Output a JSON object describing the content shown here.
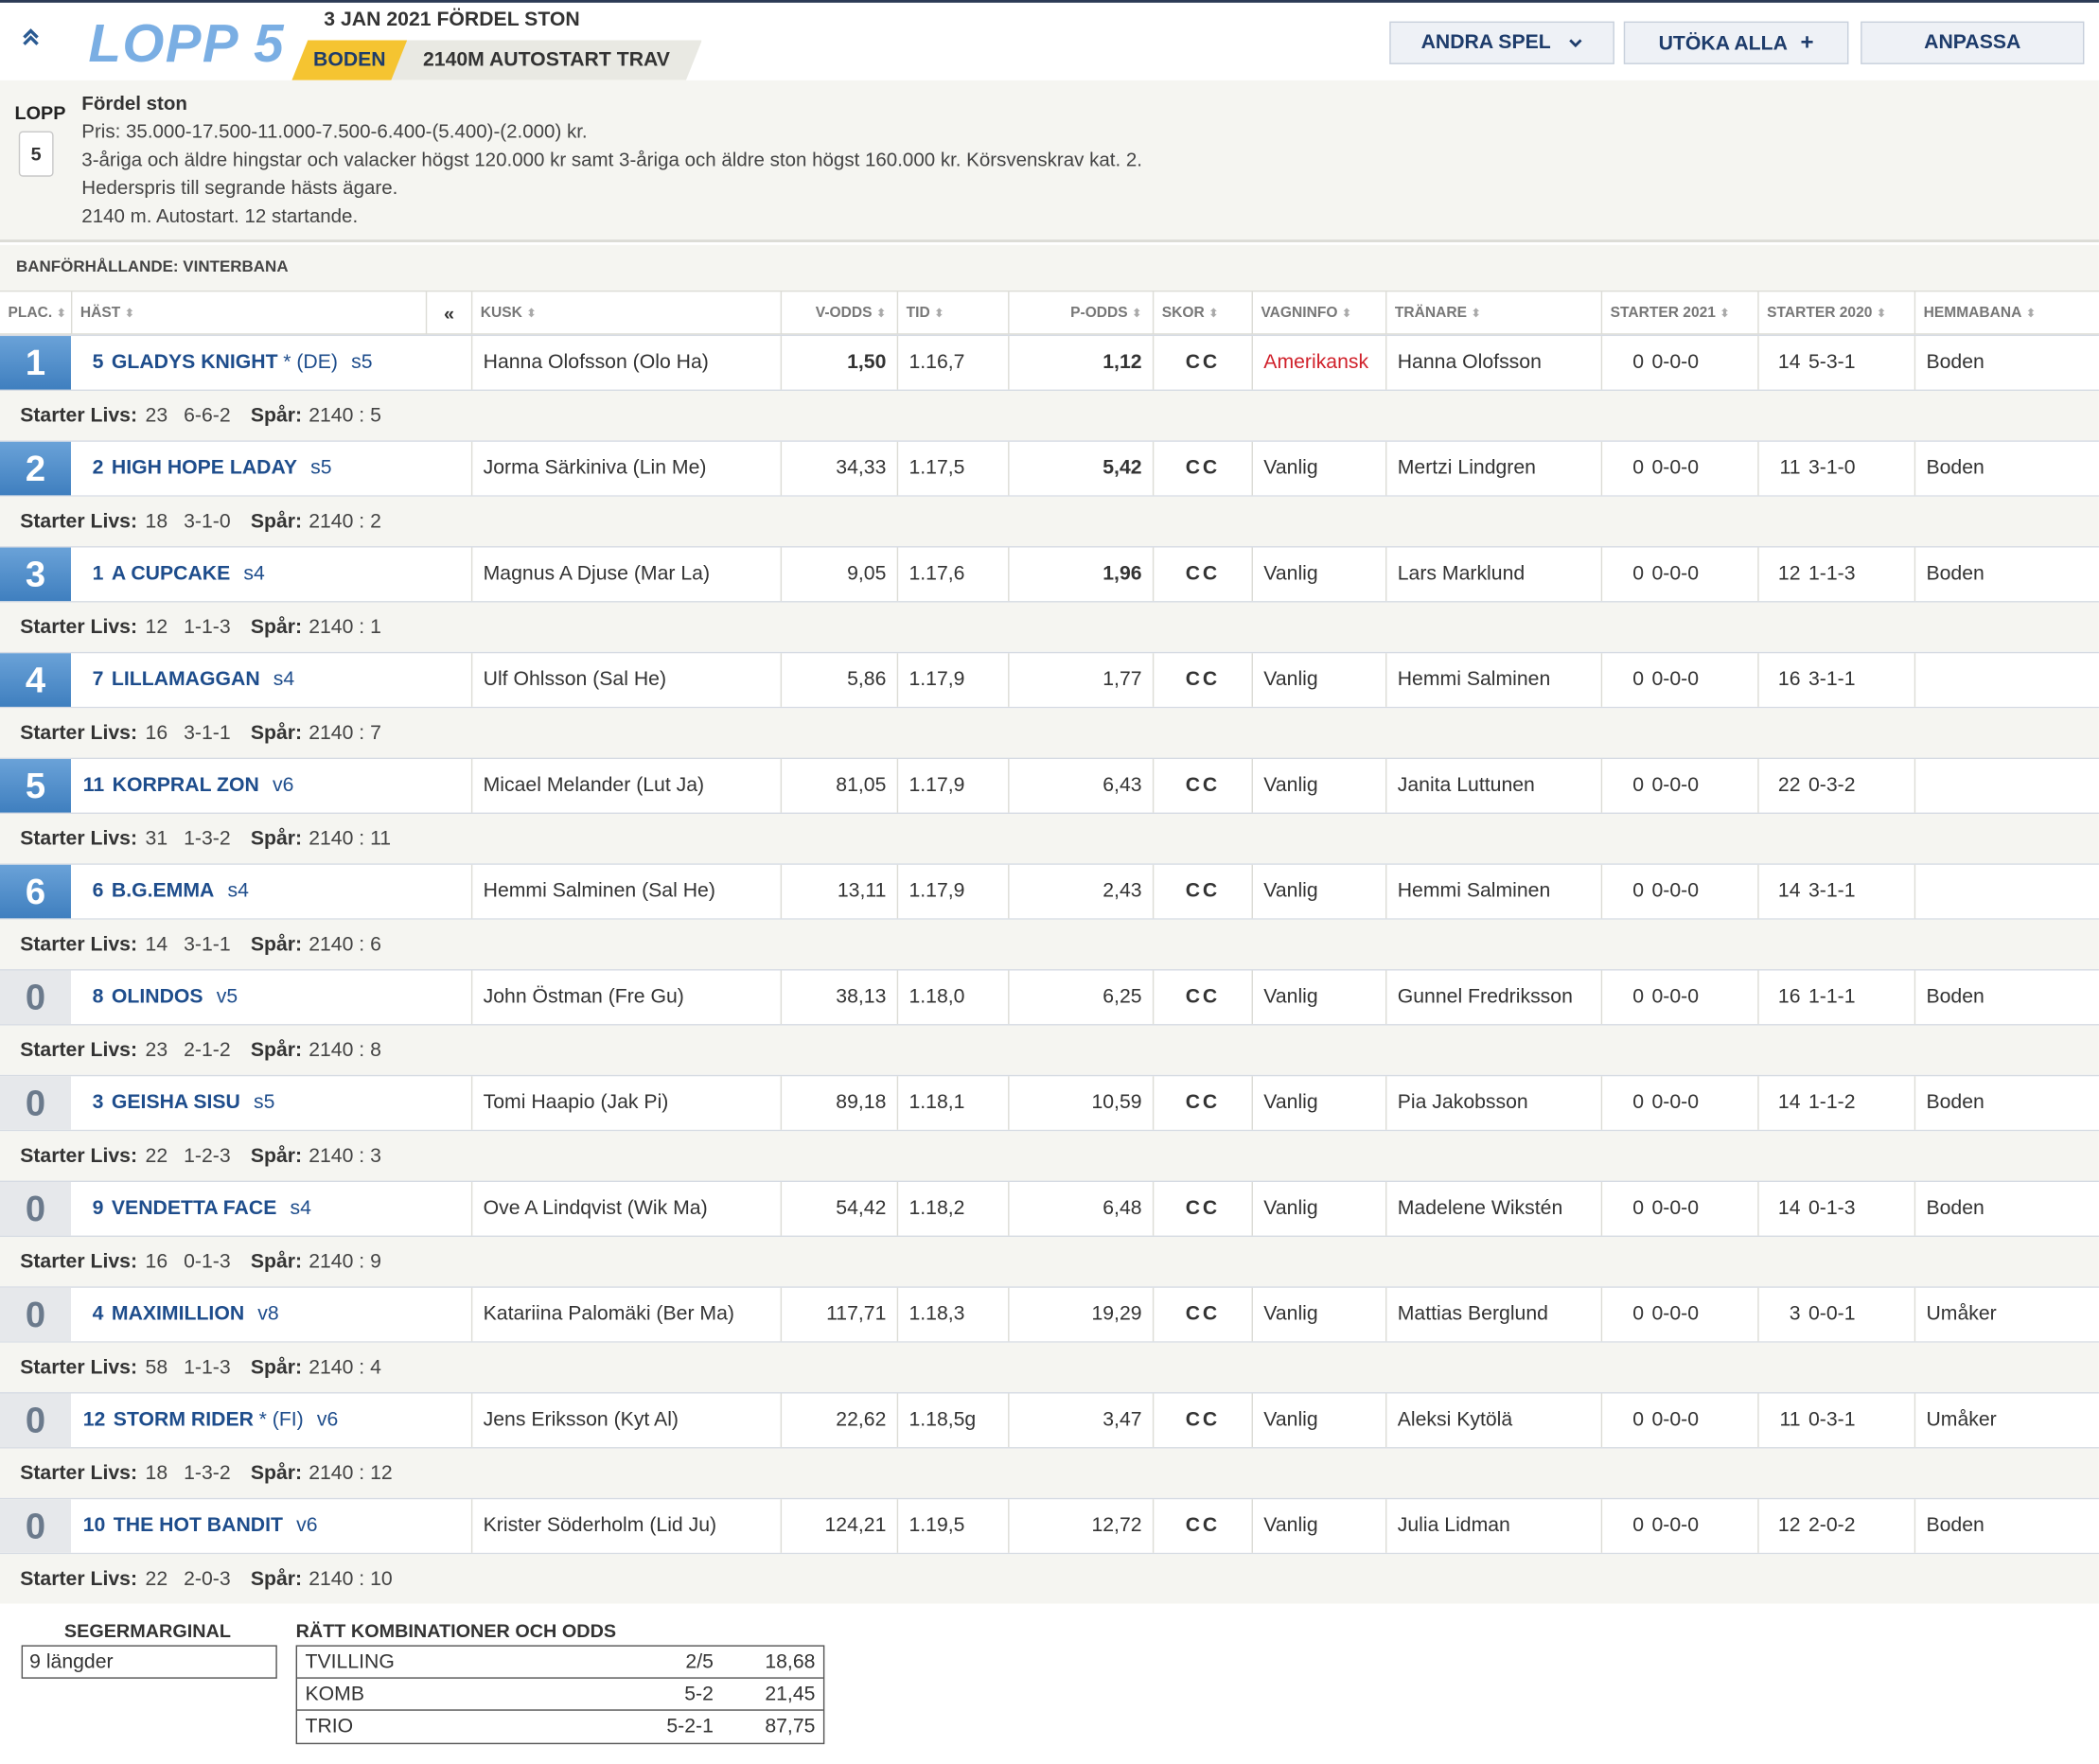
{
  "header": {
    "title": "LOPP 5",
    "date": "3 JAN 2021 FÖRDEL STON",
    "venue": "BODEN",
    "distance": "2140M AUTOSTART TRAV",
    "buttons": {
      "andra_spel": "ANDRA SPEL",
      "utoka_alla": "UTÖKA ALLA",
      "anpassa": "ANPASSA"
    }
  },
  "race_info": {
    "lopp_label": "LOPP",
    "lopp_number": "5",
    "title": "Fördel ston",
    "lines": [
      "Pris: 35.000-17.500-11.000-7.500-6.400-(5.400)-(2.000) kr.",
      "3-åriga och äldre hingstar och valacker högst 120.000 kr samt 3-åriga och äldre ston högst 160.000 kr. Körsvenskrav kat. 2.",
      "Hederspris till segrande hästs ägare.",
      "2140 m. Autostart. 12 startande."
    ]
  },
  "track_condition": "BANFÖRHÅLLANDE: VINTERBANA",
  "columns": {
    "plac": "PLAC.",
    "hast": "HÄST",
    "kusk": "KUSK",
    "vodds": "V-ODDS",
    "tid": "TID",
    "podds": "P-ODDS",
    "skor": "SKOR",
    "vagninfo": "VAGNINFO",
    "tranare": "TRÄNARE",
    "starter2021": "STARTER 2021",
    "starter2020": "STARTER 2020",
    "hemmabana": "HEMMABANA",
    "collapse": "«"
  },
  "sub_labels": {
    "starter_livs": "Starter Livs:",
    "spar": "Spår:"
  },
  "rows": [
    {
      "plac": "1",
      "num": "5",
      "name": "GLADYS KNIGHT",
      "suffix": "* (DE)",
      "age": "s5",
      "kusk": "Hanna Olofsson (Olo Ha)",
      "vodds": "1,50",
      "vodds_bold": true,
      "tid": "1.16,7",
      "podds": "1,12",
      "podds_bold": true,
      "skor": "CC",
      "skor_red": false,
      "vagn": "Amerikansk",
      "vagn_red": true,
      "tranare": "Hanna Olofsson",
      "s21a": "0",
      "s21b": "0-0-0",
      "s20a": "14",
      "s20b": "5-3-1",
      "hemma": "Boden",
      "livs_a": "23",
      "livs_b": "6-6-2",
      "spar": "2140 : 5"
    },
    {
      "plac": "2",
      "num": "2",
      "name": "HIGH HOPE LADAY",
      "suffix": "",
      "age": "s5",
      "kusk": "Jorma Särkiniva (Lin Me)",
      "vodds": "34,33",
      "vodds_bold": false,
      "tid": "1.17,5",
      "podds": "5,42",
      "podds_bold": true,
      "skor": "CC",
      "skor_red": true,
      "vagn": "Vanlig",
      "vagn_red": false,
      "tranare": "Mertzi Lindgren",
      "s21a": "0",
      "s21b": "0-0-0",
      "s20a": "11",
      "s20b": "3-1-0",
      "hemma": "Boden",
      "livs_a": "18",
      "livs_b": "3-1-0",
      "spar": "2140 : 2"
    },
    {
      "plac": "3",
      "num": "1",
      "name": "A CUPCAKE",
      "suffix": "",
      "age": "s4",
      "kusk": "Magnus A Djuse (Mar La)",
      "vodds": "9,05",
      "vodds_bold": false,
      "tid": "1.17,6",
      "podds": "1,96",
      "podds_bold": true,
      "skor": "CC",
      "skor_red": false,
      "vagn": "Vanlig",
      "vagn_red": false,
      "tranare": "Lars Marklund",
      "s21a": "0",
      "s21b": "0-0-0",
      "s20a": "12",
      "s20b": "1-1-3",
      "hemma": "Boden",
      "livs_a": "12",
      "livs_b": "1-1-3",
      "spar": "2140 : 1"
    },
    {
      "plac": "4",
      "num": "7",
      "name": "LILLAMAGGAN",
      "suffix": "",
      "age": "s4",
      "kusk": "Ulf Ohlsson (Sal He)",
      "vodds": "5,86",
      "vodds_bold": false,
      "tid": "1.17,9",
      "podds": "1,77",
      "podds_bold": false,
      "skor": "CC",
      "skor_red": false,
      "vagn": "Vanlig",
      "vagn_red": false,
      "tranare": "Hemmi Salminen",
      "s21a": "0",
      "s21b": "0-0-0",
      "s20a": "16",
      "s20b": "3-1-1",
      "hemma": "",
      "livs_a": "16",
      "livs_b": "3-1-1",
      "spar": "2140 : 7"
    },
    {
      "plac": "5",
      "num": "11",
      "name": "KORPRAL ZON",
      "suffix": "",
      "age": "v6",
      "kusk": "Micael Melander (Lut Ja)",
      "vodds": "81,05",
      "vodds_bold": false,
      "tid": "1.17,9",
      "podds": "6,43",
      "podds_bold": false,
      "skor": "CC",
      "skor_red": false,
      "vagn": "Vanlig",
      "vagn_red": false,
      "tranare": "Janita Luttunen",
      "s21a": "0",
      "s21b": "0-0-0",
      "s20a": "22",
      "s20b": "0-3-2",
      "hemma": "",
      "livs_a": "31",
      "livs_b": "1-3-2",
      "spar": "2140 : 11"
    },
    {
      "plac": "6",
      "num": "6",
      "name": "B.G.EMMA",
      "suffix": "",
      "age": "s4",
      "kusk": "Hemmi Salminen (Sal He)",
      "vodds": "13,11",
      "vodds_bold": false,
      "tid": "1.17,9",
      "podds": "2,43",
      "podds_bold": false,
      "skor": "CC",
      "skor_red": false,
      "vagn": "Vanlig",
      "vagn_red": false,
      "tranare": "Hemmi Salminen",
      "s21a": "0",
      "s21b": "0-0-0",
      "s20a": "14",
      "s20b": "3-1-1",
      "hemma": "",
      "livs_a": "14",
      "livs_b": "3-1-1",
      "spar": "2140 : 6"
    },
    {
      "plac": "0",
      "num": "8",
      "name": "OLINDOS",
      "suffix": "",
      "age": "v5",
      "kusk": "John Östman (Fre Gu)",
      "vodds": "38,13",
      "vodds_bold": false,
      "tid": "1.18,0",
      "podds": "6,25",
      "podds_bold": false,
      "skor": "CC",
      "skor_red": false,
      "vagn": "Vanlig",
      "vagn_red": false,
      "tranare": "Gunnel Fredriksson",
      "s21a": "0",
      "s21b": "0-0-0",
      "s20a": "16",
      "s20b": "1-1-1",
      "hemma": "Boden",
      "livs_a": "23",
      "livs_b": "2-1-2",
      "spar": "2140 : 8"
    },
    {
      "plac": "0",
      "num": "3",
      "name": "GEISHA SISU",
      "suffix": "",
      "age": "s5",
      "kusk": "Tomi Haapio (Jak Pi)",
      "vodds": "89,18",
      "vodds_bold": false,
      "tid": "1.18,1",
      "podds": "10,59",
      "podds_bold": false,
      "skor": "CC",
      "skor_red": false,
      "vagn": "Vanlig",
      "vagn_red": false,
      "tranare": "Pia Jakobsson",
      "s21a": "0",
      "s21b": "0-0-0",
      "s20a": "14",
      "s20b": "1-1-2",
      "hemma": "Boden",
      "livs_a": "22",
      "livs_b": "1-2-3",
      "spar": "2140 : 3"
    },
    {
      "plac": "0",
      "num": "9",
      "name": "VENDETTA FACE",
      "suffix": "",
      "age": "s4",
      "kusk": "Ove A Lindqvist (Wik Ma)",
      "vodds": "54,42",
      "vodds_bold": false,
      "tid": "1.18,2",
      "podds": "6,48",
      "podds_bold": false,
      "skor": "CC",
      "skor_red": false,
      "vagn": "Vanlig",
      "vagn_red": false,
      "tranare": "Madelene Wikstén",
      "s21a": "0",
      "s21b": "0-0-0",
      "s20a": "14",
      "s20b": "0-1-3",
      "hemma": "Boden",
      "livs_a": "16",
      "livs_b": "0-1-3",
      "spar": "2140 : 9"
    },
    {
      "plac": "0",
      "num": "4",
      "name": "MAXIMILLION",
      "suffix": "",
      "age": "v8",
      "kusk": "Katariina Palomäki (Ber Ma)",
      "vodds": "117,71",
      "vodds_bold": false,
      "tid": "1.18,3",
      "podds": "19,29",
      "podds_bold": false,
      "skor": "CC",
      "skor_red": false,
      "vagn": "Vanlig",
      "vagn_red": false,
      "tranare": "Mattias Berglund",
      "s21a": "0",
      "s21b": "0-0-0",
      "s20a": "3",
      "s20b": "0-0-1",
      "hemma": "Umåker",
      "livs_a": "58",
      "livs_b": "1-1-3",
      "spar": "2140 : 4"
    },
    {
      "plac": "0",
      "num": "12",
      "name": "STORM RIDER",
      "suffix": "* (FI)",
      "age": "v6",
      "kusk": "Jens Eriksson (Kyt Al)",
      "vodds": "22,62",
      "vodds_bold": false,
      "tid": "1.18,5g",
      "podds": "3,47",
      "podds_bold": false,
      "skor": "CC",
      "skor_red": false,
      "vagn": "Vanlig",
      "vagn_red": false,
      "tranare": "Aleksi Kytölä",
      "s21a": "0",
      "s21b": "0-0-0",
      "s20a": "11",
      "s20b": "0-3-1",
      "hemma": "Umåker",
      "livs_a": "18",
      "livs_b": "1-3-2",
      "spar": "2140 : 12"
    },
    {
      "plac": "0",
      "num": "10",
      "name": "THE HOT BANDIT",
      "suffix": "",
      "age": "v6",
      "kusk": "Krister Söderholm (Lid Ju)",
      "vodds": "124,21",
      "vodds_bold": false,
      "tid": "1.19,5",
      "podds": "12,72",
      "podds_bold": false,
      "skor": "CC",
      "skor_red": false,
      "vagn": "Vanlig",
      "vagn_red": false,
      "tranare": "Julia Lidman",
      "s21a": "0",
      "s21b": "0-0-0",
      "s20a": "12",
      "s20b": "2-0-2",
      "hemma": "Boden",
      "livs_a": "22",
      "livs_b": "2-0-3",
      "spar": "2140 : 10"
    }
  ],
  "footer": {
    "segermarginal_title": "SEGERMARGINAL",
    "segermarginal_value": "9 längder",
    "ratt_title": "RÄTT KOMBINATIONER OCH ODDS",
    "ratt": [
      {
        "type": "TVILLING",
        "combo": "2/5",
        "odds": "18,68"
      },
      {
        "type": "KOMB",
        "combo": "5-2",
        "odds": "21,45"
      },
      {
        "type": "TRIO",
        "combo": "5-2-1",
        "odds": "87,75"
      }
    ]
  },
  "colors": {
    "accent_blue": "#1e4d8c",
    "win_blue": "#4f8ccb",
    "venue_yellow": "#f5c431",
    "red": "#d0202a"
  }
}
